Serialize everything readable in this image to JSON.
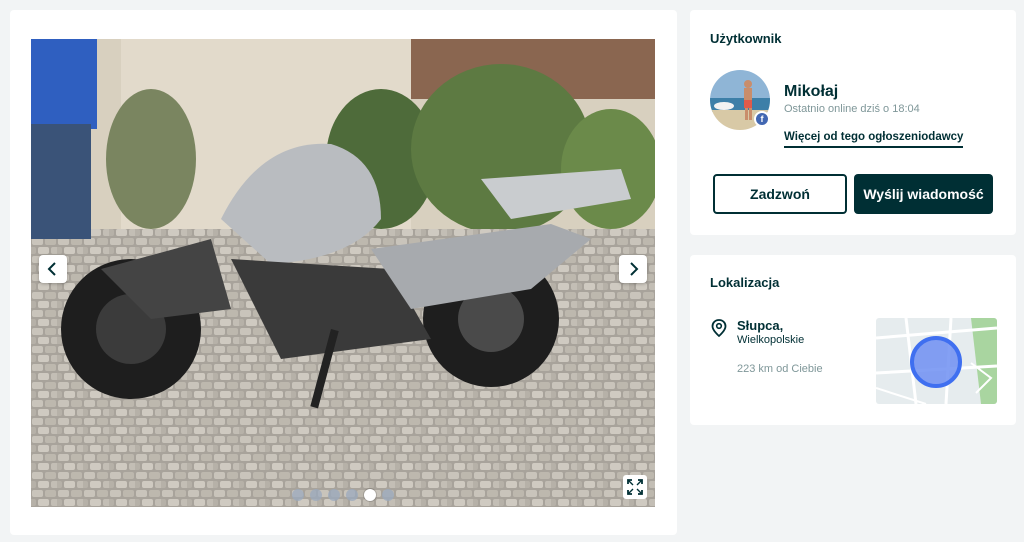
{
  "gallery": {
    "prev_icon": "chevron-left-icon",
    "next_icon": "chevron-right-icon",
    "fullscreen_icon": "expand-icon",
    "photo_count": 6,
    "active_index": 4
  },
  "user": {
    "section_title": "Użytkownik",
    "name": "Mikołaj",
    "last_online": "Ostatnio online dziś o 18:04",
    "more_link": "Więcej od tego ogłoszeniodawcy",
    "badge_icon": "facebook-icon",
    "call_button": "Zadzwoń",
    "message_button": "Wyślij wiadomość"
  },
  "location": {
    "section_title": "Lokalizacja",
    "city": "Słupca,",
    "region": "Wielkopolskie",
    "distance": "223 km od Ciebie",
    "pin_icon": "map-pin-icon"
  },
  "colors": {
    "primary": "#002f34",
    "muted": "#7f9799",
    "facebook": "#4267b2",
    "map_circle": "#3f6ff0",
    "background": "#f2f4f5"
  }
}
